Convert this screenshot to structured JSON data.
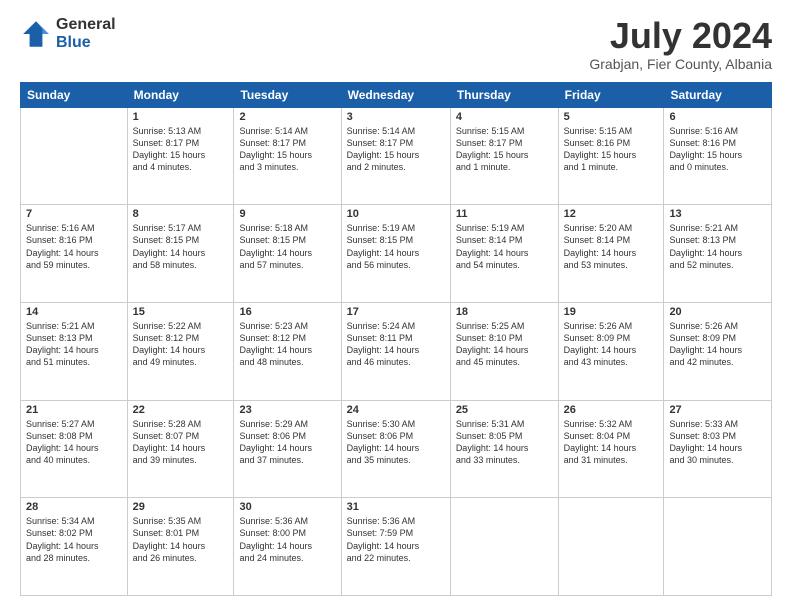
{
  "logo": {
    "general": "General",
    "blue": "Blue"
  },
  "title": "July 2024",
  "subtitle": "Grabjan, Fier County, Albania",
  "headers": [
    "Sunday",
    "Monday",
    "Tuesday",
    "Wednesday",
    "Thursday",
    "Friday",
    "Saturday"
  ],
  "weeks": [
    [
      {
        "day": "",
        "info": ""
      },
      {
        "day": "1",
        "info": "Sunrise: 5:13 AM\nSunset: 8:17 PM\nDaylight: 15 hours\nand 4 minutes."
      },
      {
        "day": "2",
        "info": "Sunrise: 5:14 AM\nSunset: 8:17 PM\nDaylight: 15 hours\nand 3 minutes."
      },
      {
        "day": "3",
        "info": "Sunrise: 5:14 AM\nSunset: 8:17 PM\nDaylight: 15 hours\nand 2 minutes."
      },
      {
        "day": "4",
        "info": "Sunrise: 5:15 AM\nSunset: 8:17 PM\nDaylight: 15 hours\nand 1 minute."
      },
      {
        "day": "5",
        "info": "Sunrise: 5:15 AM\nSunset: 8:16 PM\nDaylight: 15 hours\nand 1 minute."
      },
      {
        "day": "6",
        "info": "Sunrise: 5:16 AM\nSunset: 8:16 PM\nDaylight: 15 hours\nand 0 minutes."
      }
    ],
    [
      {
        "day": "7",
        "info": "Sunrise: 5:16 AM\nSunset: 8:16 PM\nDaylight: 14 hours\nand 59 minutes."
      },
      {
        "day": "8",
        "info": "Sunrise: 5:17 AM\nSunset: 8:15 PM\nDaylight: 14 hours\nand 58 minutes."
      },
      {
        "day": "9",
        "info": "Sunrise: 5:18 AM\nSunset: 8:15 PM\nDaylight: 14 hours\nand 57 minutes."
      },
      {
        "day": "10",
        "info": "Sunrise: 5:19 AM\nSunset: 8:15 PM\nDaylight: 14 hours\nand 56 minutes."
      },
      {
        "day": "11",
        "info": "Sunrise: 5:19 AM\nSunset: 8:14 PM\nDaylight: 14 hours\nand 54 minutes."
      },
      {
        "day": "12",
        "info": "Sunrise: 5:20 AM\nSunset: 8:14 PM\nDaylight: 14 hours\nand 53 minutes."
      },
      {
        "day": "13",
        "info": "Sunrise: 5:21 AM\nSunset: 8:13 PM\nDaylight: 14 hours\nand 52 minutes."
      }
    ],
    [
      {
        "day": "14",
        "info": "Sunrise: 5:21 AM\nSunset: 8:13 PM\nDaylight: 14 hours\nand 51 minutes."
      },
      {
        "day": "15",
        "info": "Sunrise: 5:22 AM\nSunset: 8:12 PM\nDaylight: 14 hours\nand 49 minutes."
      },
      {
        "day": "16",
        "info": "Sunrise: 5:23 AM\nSunset: 8:12 PM\nDaylight: 14 hours\nand 48 minutes."
      },
      {
        "day": "17",
        "info": "Sunrise: 5:24 AM\nSunset: 8:11 PM\nDaylight: 14 hours\nand 46 minutes."
      },
      {
        "day": "18",
        "info": "Sunrise: 5:25 AM\nSunset: 8:10 PM\nDaylight: 14 hours\nand 45 minutes."
      },
      {
        "day": "19",
        "info": "Sunrise: 5:26 AM\nSunset: 8:09 PM\nDaylight: 14 hours\nand 43 minutes."
      },
      {
        "day": "20",
        "info": "Sunrise: 5:26 AM\nSunset: 8:09 PM\nDaylight: 14 hours\nand 42 minutes."
      }
    ],
    [
      {
        "day": "21",
        "info": "Sunrise: 5:27 AM\nSunset: 8:08 PM\nDaylight: 14 hours\nand 40 minutes."
      },
      {
        "day": "22",
        "info": "Sunrise: 5:28 AM\nSunset: 8:07 PM\nDaylight: 14 hours\nand 39 minutes."
      },
      {
        "day": "23",
        "info": "Sunrise: 5:29 AM\nSunset: 8:06 PM\nDaylight: 14 hours\nand 37 minutes."
      },
      {
        "day": "24",
        "info": "Sunrise: 5:30 AM\nSunset: 8:06 PM\nDaylight: 14 hours\nand 35 minutes."
      },
      {
        "day": "25",
        "info": "Sunrise: 5:31 AM\nSunset: 8:05 PM\nDaylight: 14 hours\nand 33 minutes."
      },
      {
        "day": "26",
        "info": "Sunrise: 5:32 AM\nSunset: 8:04 PM\nDaylight: 14 hours\nand 31 minutes."
      },
      {
        "day": "27",
        "info": "Sunrise: 5:33 AM\nSunset: 8:03 PM\nDaylight: 14 hours\nand 30 minutes."
      }
    ],
    [
      {
        "day": "28",
        "info": "Sunrise: 5:34 AM\nSunset: 8:02 PM\nDaylight: 14 hours\nand 28 minutes."
      },
      {
        "day": "29",
        "info": "Sunrise: 5:35 AM\nSunset: 8:01 PM\nDaylight: 14 hours\nand 26 minutes."
      },
      {
        "day": "30",
        "info": "Sunrise: 5:36 AM\nSunset: 8:00 PM\nDaylight: 14 hours\nand 24 minutes."
      },
      {
        "day": "31",
        "info": "Sunrise: 5:36 AM\nSunset: 7:59 PM\nDaylight: 14 hours\nand 22 minutes."
      },
      {
        "day": "",
        "info": ""
      },
      {
        "day": "",
        "info": ""
      },
      {
        "day": "",
        "info": ""
      }
    ]
  ]
}
